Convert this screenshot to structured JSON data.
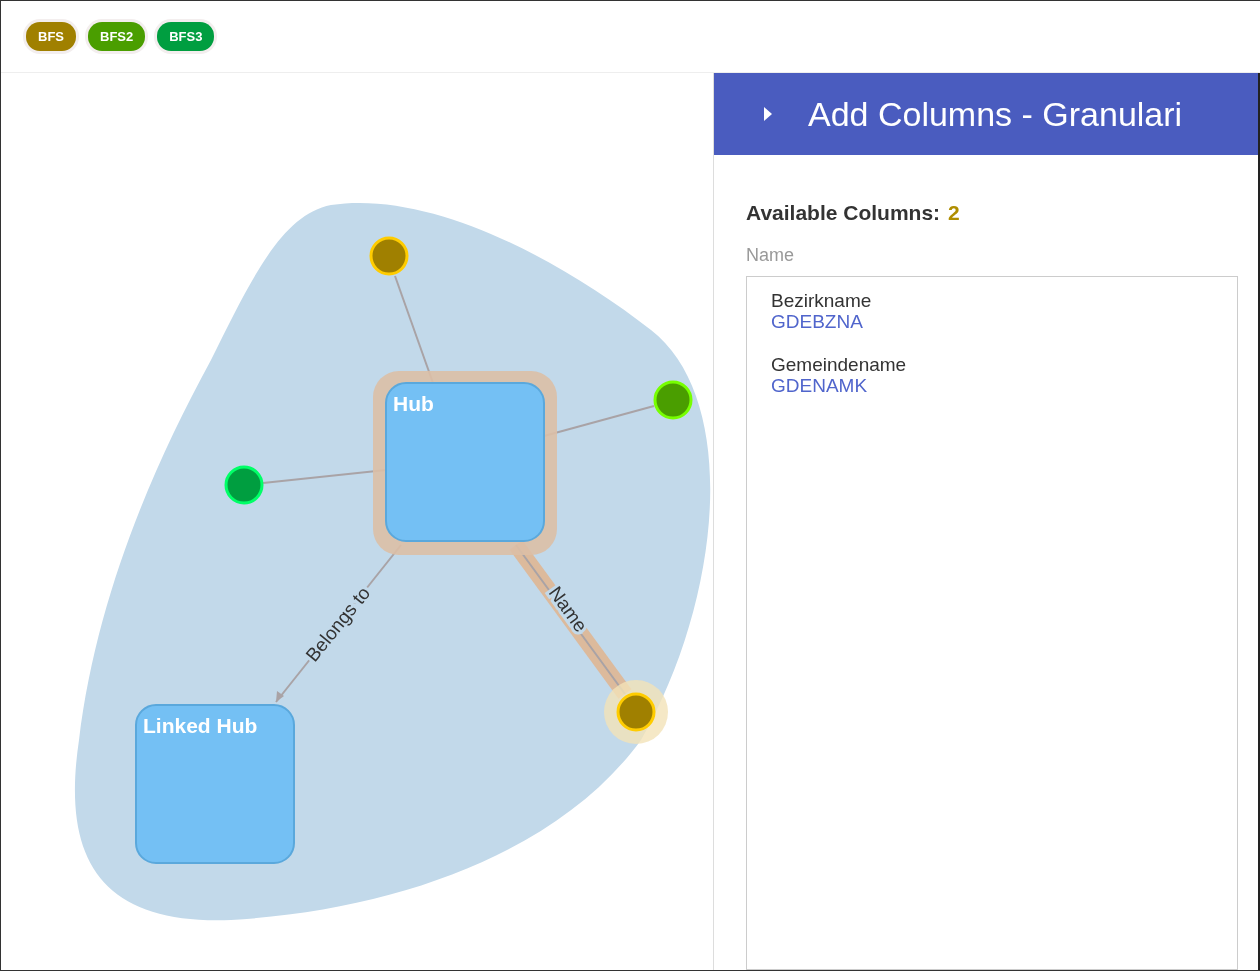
{
  "tags": [
    {
      "label": "BFS",
      "color": "#a08000"
    },
    {
      "label": "BFS2",
      "color": "#4a9e00"
    },
    {
      "label": "BFS3",
      "color": "#009e40"
    }
  ],
  "graph": {
    "hubs": [
      {
        "label": "Hub",
        "selected": true
      },
      {
        "label": "Linked Hub",
        "selected": false
      }
    ],
    "attributes": [
      {
        "color": "#a08000",
        "selected": false
      },
      {
        "color": "#4a9e00",
        "selected": false
      },
      {
        "color": "#009e40",
        "selected": false
      },
      {
        "color": "#a08000",
        "selected": true
      }
    ],
    "edges": [
      {
        "label": "Belongs to",
        "selected": false
      },
      {
        "label": "Name",
        "selected": true
      }
    ]
  },
  "panel": {
    "title": "Add Columns - Granulari",
    "heading": "Available Columns:",
    "count": "2",
    "list_label": "Name",
    "columns": [
      {
        "name": "Bezirkname",
        "code": "GDEBZNA"
      },
      {
        "name": "Gemeindename",
        "code": "GDENAMK"
      }
    ]
  }
}
